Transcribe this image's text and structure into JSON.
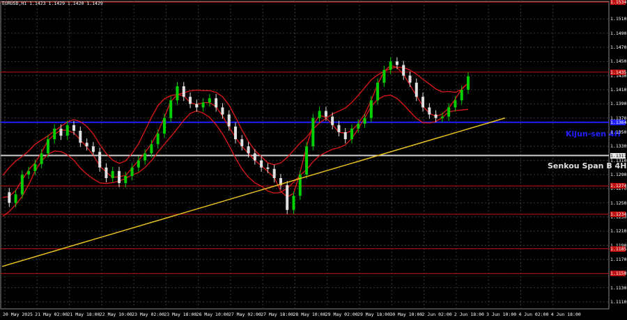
{
  "header": {
    "symbol_text": "EURUSD,H1  1.1423 1.1429 1.1420 1.1429"
  },
  "colors": {
    "background": "#000000",
    "level_red": "#c01010",
    "kijun": "#2020ff",
    "senkou": "#d0d0d0",
    "trendline": "#e8c020",
    "bullish": "#00d000",
    "bearish": "#e0e0e0",
    "ichimoku_band": "#e01818"
  },
  "price_axis": {
    "ticks": [
      "1.1510",
      "1.1490",
      "1.1470",
      "1.1450",
      "1.1430",
      "1.1410",
      "1.1390",
      "1.1370",
      "1.1350",
      "1.1330",
      "1.1310",
      "1.1290",
      "1.1270",
      "1.1250",
      "1.1230",
      "1.1210",
      "1.1190",
      "1.1170",
      "1.1150",
      "1.1130",
      "1.1110"
    ],
    "range": [
      1.11,
      1.1535
    ]
  },
  "levels": {
    "red": [
      {
        "label": "1.1534",
        "price": 1.1534
      },
      {
        "label": "1.1435",
        "price": 1.1435
      },
      {
        "label": "1.1364",
        "price": 1.1364
      },
      {
        "label": "1.1274",
        "price": 1.1274
      },
      {
        "label": "1.1234",
        "price": 1.1234
      },
      {
        "label": "1.1185",
        "price": 1.1185
      },
      {
        "label": "1.1150",
        "price": 1.115
      }
    ],
    "kijun": {
      "label": "Kijun-sen 4H",
      "price_label": "1.1364",
      "price": 1.1364
    },
    "senkou": {
      "label": "Senkou Span B 4H",
      "price_label": "1.1317",
      "price": 1.1317
    }
  },
  "time_axis": {
    "labels": [
      "20 May 2025",
      "21 May 02:00",
      "21 May 18:00",
      "22 May 10:00",
      "23 May 02:00",
      "23 May 18:00",
      "26 May 10:00",
      "27 May 02:00",
      "27 May 18:00",
      "28 May 10:00",
      "29 May 02:00",
      "29 May 18:00",
      "30 May 10:00",
      "2 Jun 02:00",
      "2 Jun 18:00",
      "3 Jun 10:00",
      "4 Jun 02:00",
      "4 Jun 18:00"
    ]
  },
  "chart_data": {
    "type": "line",
    "title": "EURUSD,H1",
    "xlabel": "",
    "ylabel": "",
    "ylim": [
      1.11,
      1.1535
    ],
    "close_path": [
      1.1265,
      1.125,
      1.1262,
      1.129,
      1.1295,
      1.1305,
      1.132,
      1.134,
      1.1355,
      1.1345,
      1.136,
      1.1352,
      1.1335,
      1.133,
      1.1322,
      1.13,
      1.1285,
      1.1295,
      1.1278,
      1.1288,
      1.13,
      1.131,
      1.132,
      1.1333,
      1.1348,
      1.137,
      1.1395,
      1.1415,
      1.14,
      1.139,
      1.1385,
      1.1392,
      1.1398,
      1.1385,
      1.1375,
      1.1358,
      1.134,
      1.133,
      1.132,
      1.131,
      1.13,
      1.1298,
      1.1285,
      1.1275,
      1.124,
      1.126,
      1.129,
      1.133,
      1.137,
      1.138,
      1.1372,
      1.136,
      1.135,
      1.134,
      1.1355,
      1.1362,
      1.137,
      1.1395,
      1.142,
      1.1438,
      1.145,
      1.1445,
      1.143,
      1.142,
      1.14,
      1.1385,
      1.1375,
      1.137,
      1.1372,
      1.1385,
      1.1395,
      1.141,
      1.1429
    ],
    "trendline": {
      "start": 1.116,
      "end": 1.137
    }
  }
}
